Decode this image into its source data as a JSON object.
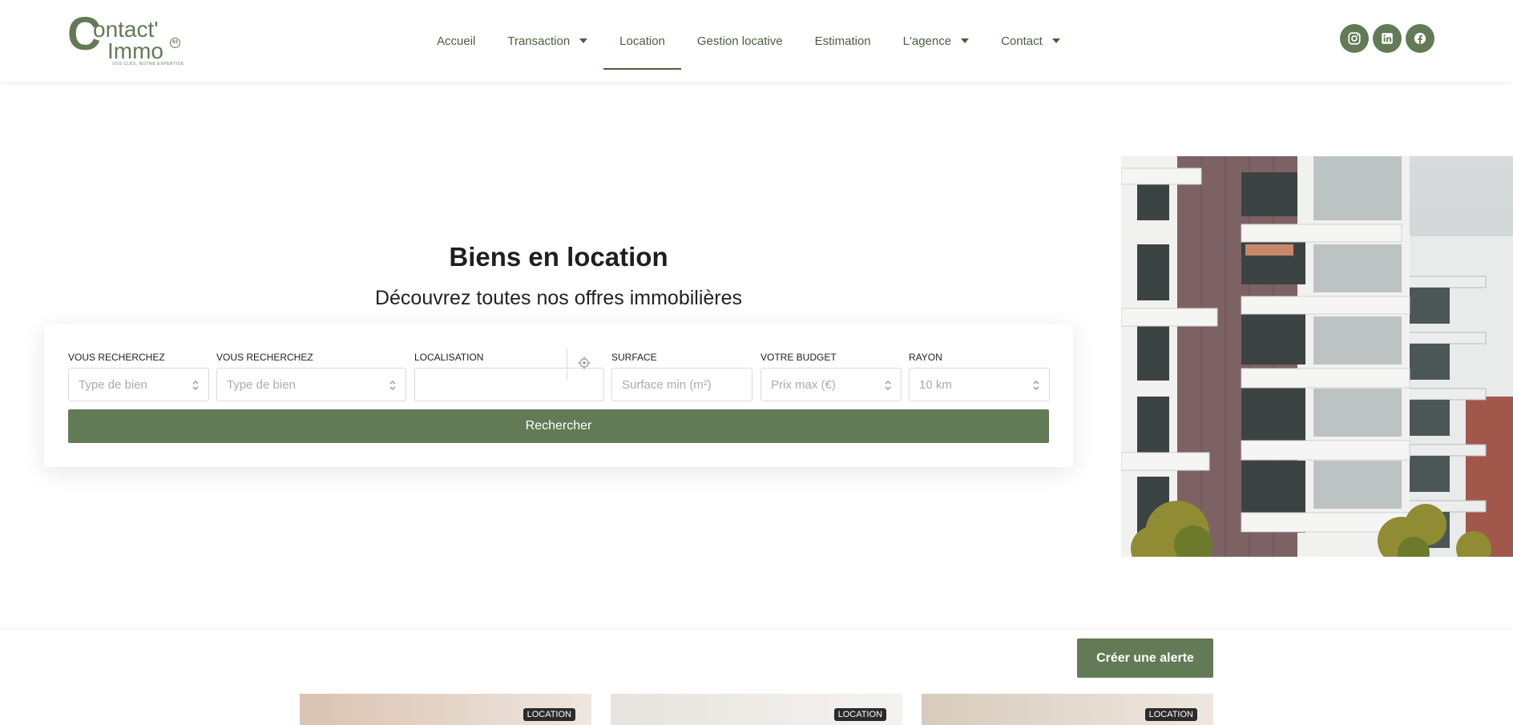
{
  "brand": {
    "line1": "ontact'",
    "line2": "Immo",
    "mark": "C",
    "badge": "63",
    "tagline": "VOS CLÉS, NOTRE EXPERTISE"
  },
  "nav": {
    "items": [
      {
        "label": "Accueil",
        "has_caret": false
      },
      {
        "label": "Transaction",
        "has_caret": true
      },
      {
        "label": "Location",
        "has_caret": false,
        "active": true
      },
      {
        "label": "Gestion locative",
        "has_caret": false
      },
      {
        "label": "Estimation",
        "has_caret": false
      },
      {
        "label": "L'agence",
        "has_caret": true
      },
      {
        "label": "Contact",
        "has_caret": true
      }
    ]
  },
  "socials": [
    "instagram-icon",
    "linkedin-icon",
    "facebook-icon"
  ],
  "hero": {
    "title": "Biens en location",
    "subtitle": "Découvrez toutes nos offres immobilières"
  },
  "search": {
    "fields": [
      {
        "label": "VOUS RECHERCHEZ",
        "placeholder": "Type de bien"
      },
      {
        "label": "VOUS RECHERCHEZ",
        "placeholder": "Type de bien"
      },
      {
        "label": "LOCALISATION",
        "placeholder": ""
      },
      {
        "label": "SURFACE",
        "placeholder": "Surface min (m²)"
      },
      {
        "label": "VOTRE BUDGET",
        "placeholder": "Prix max (€)"
      },
      {
        "label": "RAYON",
        "placeholder": "10 km"
      }
    ],
    "button_label": "Rechercher"
  },
  "alert_button": "Créer une alerte",
  "listings": [
    {
      "badge": "LOCATION"
    },
    {
      "badge": "LOCATION"
    },
    {
      "badge": "LOCATION"
    }
  ],
  "colors": {
    "accent": "#637a56",
    "accent_dark": "#4b5e40"
  }
}
